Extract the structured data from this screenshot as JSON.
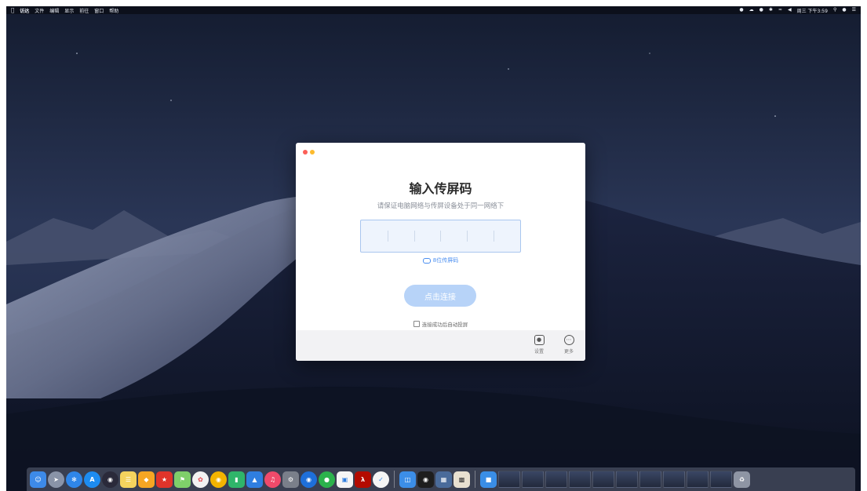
{
  "menubar": {
    "left_items": [
      "访达",
      "文件",
      "编辑",
      "显示",
      "前往",
      "窗口",
      "帮助"
    ],
    "clock": "周三 下午3:59"
  },
  "dialog": {
    "title": "输入传屏码",
    "subtitle": "请保证电脑网络与传屏设备处于同一网络下",
    "code_cells": 6,
    "code_hint": "8位传屏码",
    "connect_button": "点击连接",
    "auto_cast_label": "连接成功后自动投屏",
    "footer": {
      "settings_label": "设置",
      "more_label": "更多"
    }
  },
  "colors": {
    "accent": "#4a8ef0",
    "button_disabled": "#b7d3f8",
    "close": "#fc5f57",
    "minimize": "#fdbb2e"
  }
}
